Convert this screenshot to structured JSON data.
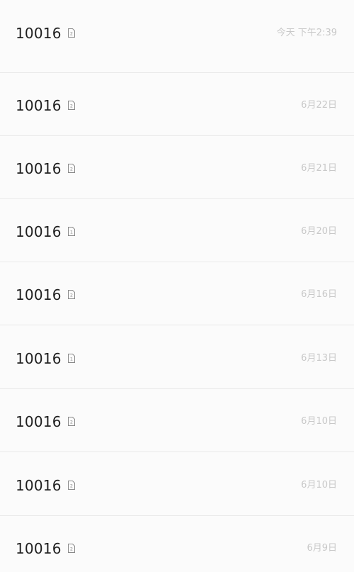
{
  "messages": [
    {
      "sender": "10016",
      "sim": "2",
      "date": "今天 下午2:39"
    },
    {
      "sender": "10016",
      "sim": "2",
      "date": "6月22日"
    },
    {
      "sender": "10016",
      "sim": "2",
      "date": "6月21日"
    },
    {
      "sender": "10016",
      "sim": "1",
      "date": "6月20日"
    },
    {
      "sender": "10016",
      "sim": "2",
      "date": "6月16日"
    },
    {
      "sender": "10016",
      "sim": "1",
      "date": "6月13日"
    },
    {
      "sender": "10016",
      "sim": "2",
      "date": "6月10日"
    },
    {
      "sender": "10016",
      "sim": "2",
      "date": "6月10日"
    },
    {
      "sender": "10016",
      "sim": "2",
      "date": "6月9日"
    }
  ]
}
